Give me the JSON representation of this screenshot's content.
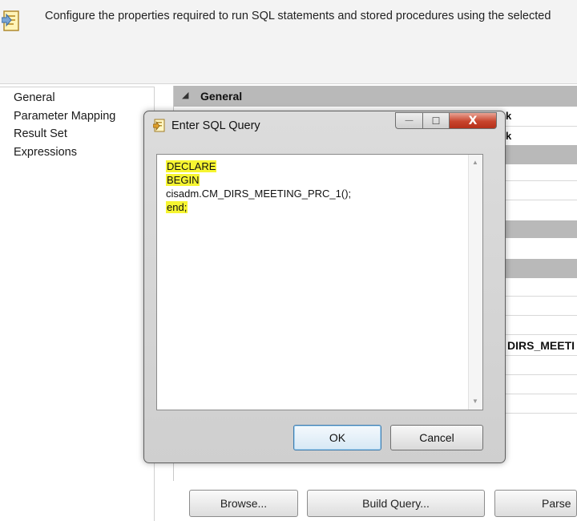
{
  "header": {
    "description": "Configure the properties required to run SQL statements and stored procedures using the selected",
    "icon": "execute-sql-task-icon"
  },
  "nav": {
    "items": [
      {
        "label": "General"
      },
      {
        "label": "Parameter Mapping"
      },
      {
        "label": "Result Set"
      },
      {
        "label": "Expressions"
      }
    ]
  },
  "property_grid": {
    "section_label": "General",
    "fragment_k": "k",
    "visible_value_fragment": "DIRS_MEETI"
  },
  "bottom_buttons": {
    "browse": "Browse...",
    "build_query": "Build Query...",
    "parse": "Parse"
  },
  "dialog": {
    "title": "Enter SQL Query",
    "caption": {
      "minimize": "—",
      "maximize": "☐",
      "close": "X"
    },
    "sql_lines": [
      "DECLARE",
      "BEGIN",
      "cisadm.CM_DIRS_MEETING_PRC_1();",
      "end;"
    ],
    "highlight_color": "#f6f531",
    "ok_label": "OK",
    "cancel_label": "Cancel"
  }
}
